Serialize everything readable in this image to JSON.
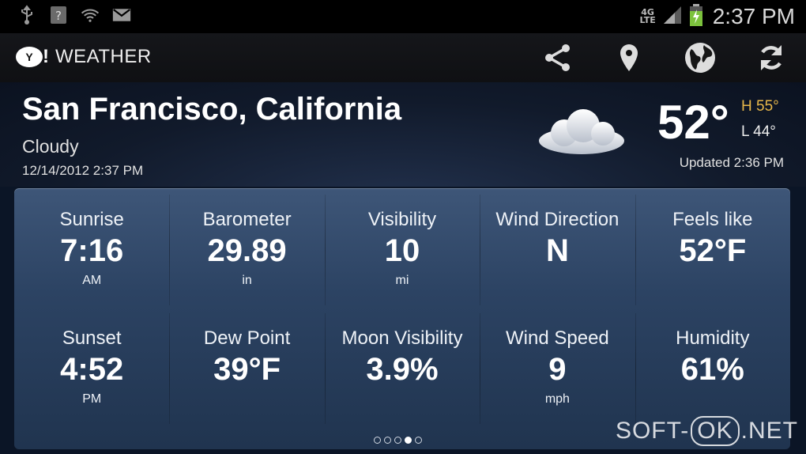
{
  "status_bar": {
    "time": "2:37 PM",
    "network": "4G",
    "network_sub": "LTE",
    "icons": [
      "usb-icon",
      "unknown-notification-icon",
      "wifi-icon",
      "gmail-icon",
      "signal-icon",
      "battery-charging-icon"
    ]
  },
  "app_bar": {
    "logo": "Y!",
    "title": "WEATHER",
    "actions": [
      "share-icon",
      "location-pin-icon",
      "globe-icon",
      "refresh-icon"
    ]
  },
  "header": {
    "city": "San Francisco, California",
    "condition": "Cloudy",
    "datetime": "12/14/2012 2:37 PM",
    "temperature": "52°",
    "high": "H 55°",
    "low": "L 44°",
    "updated": "Updated 2:36 PM",
    "weather_icon": "cloudy-icon"
  },
  "details": [
    {
      "label": "Sunrise",
      "value": "7:16",
      "unit": "AM"
    },
    {
      "label": "Barometer",
      "value": "29.89",
      "unit": "in"
    },
    {
      "label": "Visibility",
      "value": "10",
      "unit": "mi"
    },
    {
      "label": "Wind Direction",
      "value": "N",
      "unit": ""
    },
    {
      "label": "Feels like",
      "value": "52°F",
      "unit": ""
    },
    {
      "label": "Sunset",
      "value": "4:52",
      "unit": "PM"
    },
    {
      "label": "Dew Point",
      "value": "39°F",
      "unit": ""
    },
    {
      "label": "Moon Visibility",
      "value": "3.9%",
      "unit": ""
    },
    {
      "label": "Wind Speed",
      "value": "9",
      "unit": "mph"
    },
    {
      "label": "Humidity",
      "value": "61%",
      "unit": ""
    }
  ],
  "pager": {
    "pages": 5,
    "active": 3
  },
  "watermark": {
    "left": "SOFT-",
    "ok": "OK",
    "right": ".NET"
  },
  "colors": {
    "high_temp": "#e8b84a",
    "panel": "#2c4363"
  }
}
